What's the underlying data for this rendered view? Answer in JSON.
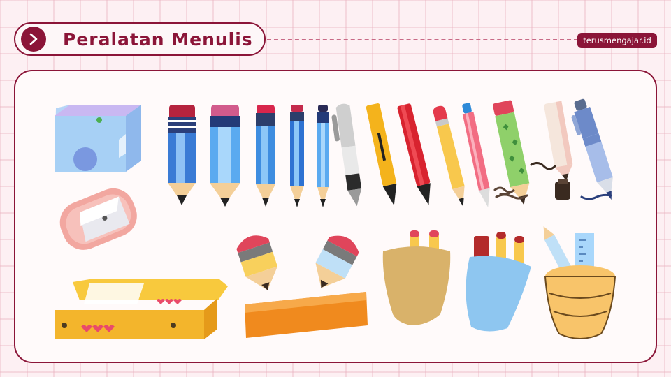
{
  "header": {
    "title": "Peralatan Menulis",
    "brand": "terusmengajar.id",
    "arrow_icon": "chevron-right-icon"
  },
  "colors": {
    "accent": "#8b1538",
    "background": "#fdf0f3",
    "grid": "#f3c9d4",
    "panel": "#fffafa"
  },
  "illustrations": [
    "pencil-sharpener-blue-icon",
    "pencil-sharpener-pink-icon",
    "pencil-icon",
    "ballpoint-pen-icon",
    "marker-icon",
    "pencil-case-icon",
    "eraser-pencil-icon",
    "ruler-icon",
    "pencil-cup-icon"
  ]
}
